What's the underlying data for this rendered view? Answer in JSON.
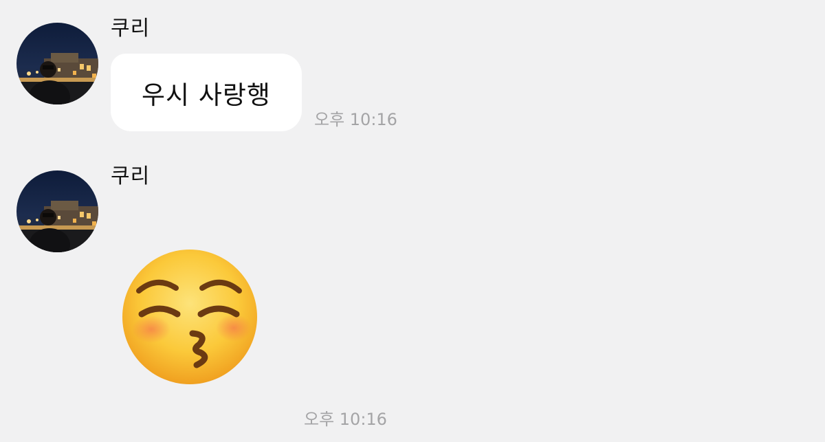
{
  "chat": {
    "messages": [
      {
        "sender": "쿠리",
        "avatar_icon": "profile-photo-night-city",
        "text": "우시 사랑행",
        "time": "오후 10:16"
      },
      {
        "sender": "쿠리",
        "avatar_icon": "profile-photo-night-city",
        "emoji": "kissing-face-with-closed-eyes",
        "time": "오후 10:16"
      }
    ]
  },
  "colors": {
    "background": "#f1f1f2",
    "bubble": "#ffffff",
    "timestamp": "#a4a4a6",
    "emoji_face": "#fbc93a"
  }
}
